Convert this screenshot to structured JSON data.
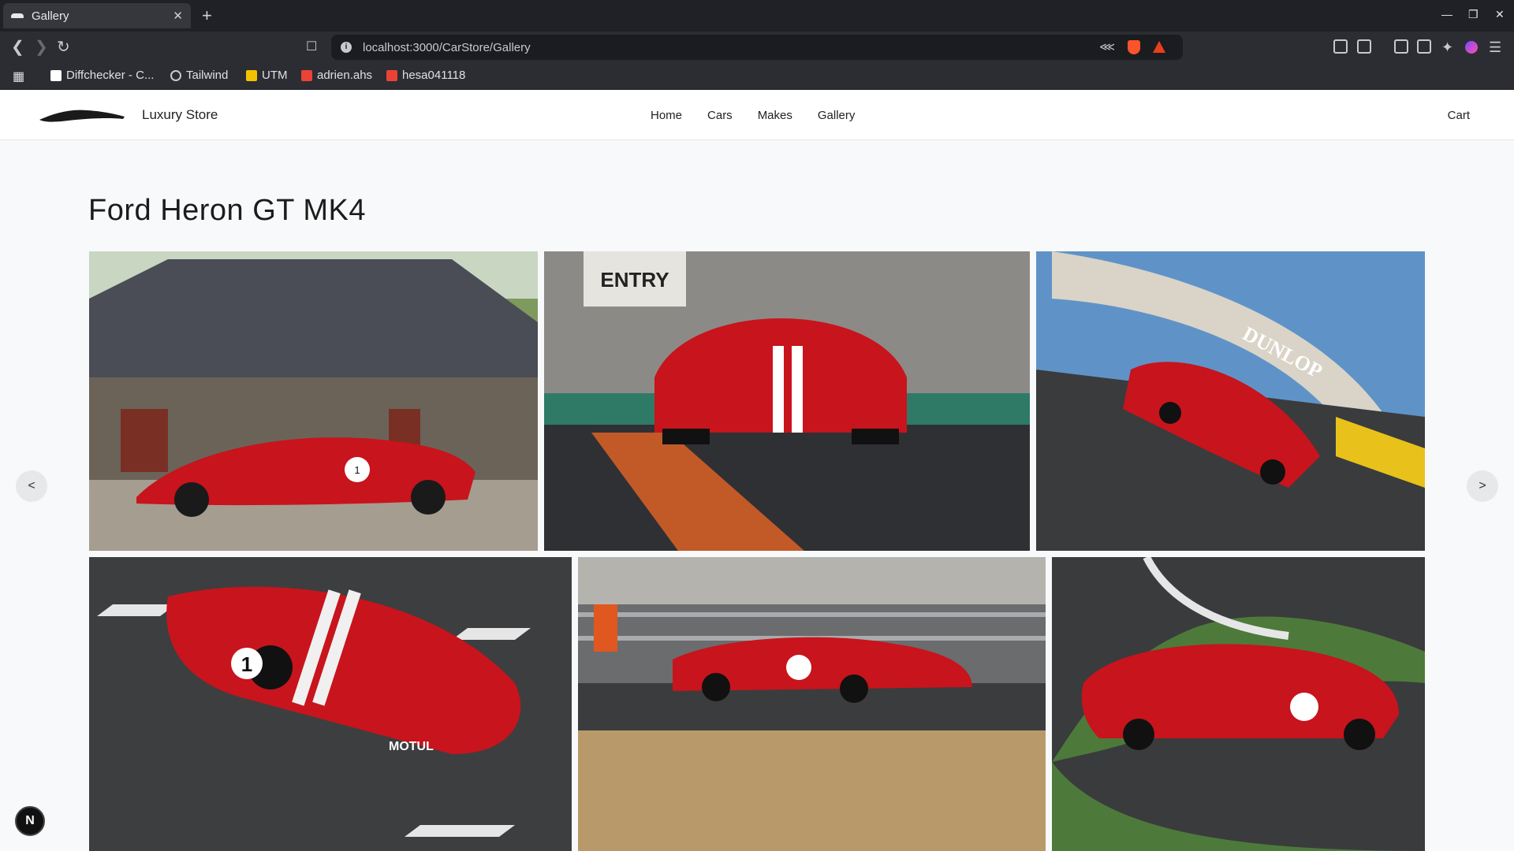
{
  "browser": {
    "tab_title": "Gallery",
    "tab_close": "✕",
    "new_tab": "+",
    "url": "localhost:3000/CarStore/Gallery",
    "bookmarks": [
      {
        "label": "Diffchecker - C...",
        "color": "#ffffff"
      },
      {
        "label": "Tailwind",
        "color": "#c9c9cd"
      },
      {
        "label": "UTM",
        "color": "#f2c200"
      },
      {
        "label": "adrien.ahs",
        "color": "#ea4335"
      },
      {
        "label": "hesa041118",
        "color": "#ea4335"
      }
    ]
  },
  "site": {
    "brand": "Luxury Store",
    "nav": [
      "Home",
      "Cars",
      "Makes",
      "Gallery"
    ],
    "cart": "Cart"
  },
  "gallery": {
    "title": "Ford Heron GT MK4",
    "prev": "<",
    "next": ">",
    "photos": [
      {
        "name": "car-by-stone-building",
        "scene": "stone building"
      },
      {
        "name": "car-at-pit-entry",
        "scene": "pit entry"
      },
      {
        "name": "car-under-dunlop-bridge",
        "scene": "dunlop bridge"
      },
      {
        "name": "car-number-1-on-track",
        "scene": "track closeup"
      },
      {
        "name": "car-passing-barrier",
        "scene": "barrier"
      },
      {
        "name": "car-cornering",
        "scene": "corner"
      }
    ],
    "pit_sign": "ENTRY",
    "bridge_text": "DUNLOP",
    "car_number": "1",
    "sponsor": "MOTUL"
  },
  "colors": {
    "car_red": "#c8141c",
    "accent": "#111111"
  },
  "badge": "N"
}
